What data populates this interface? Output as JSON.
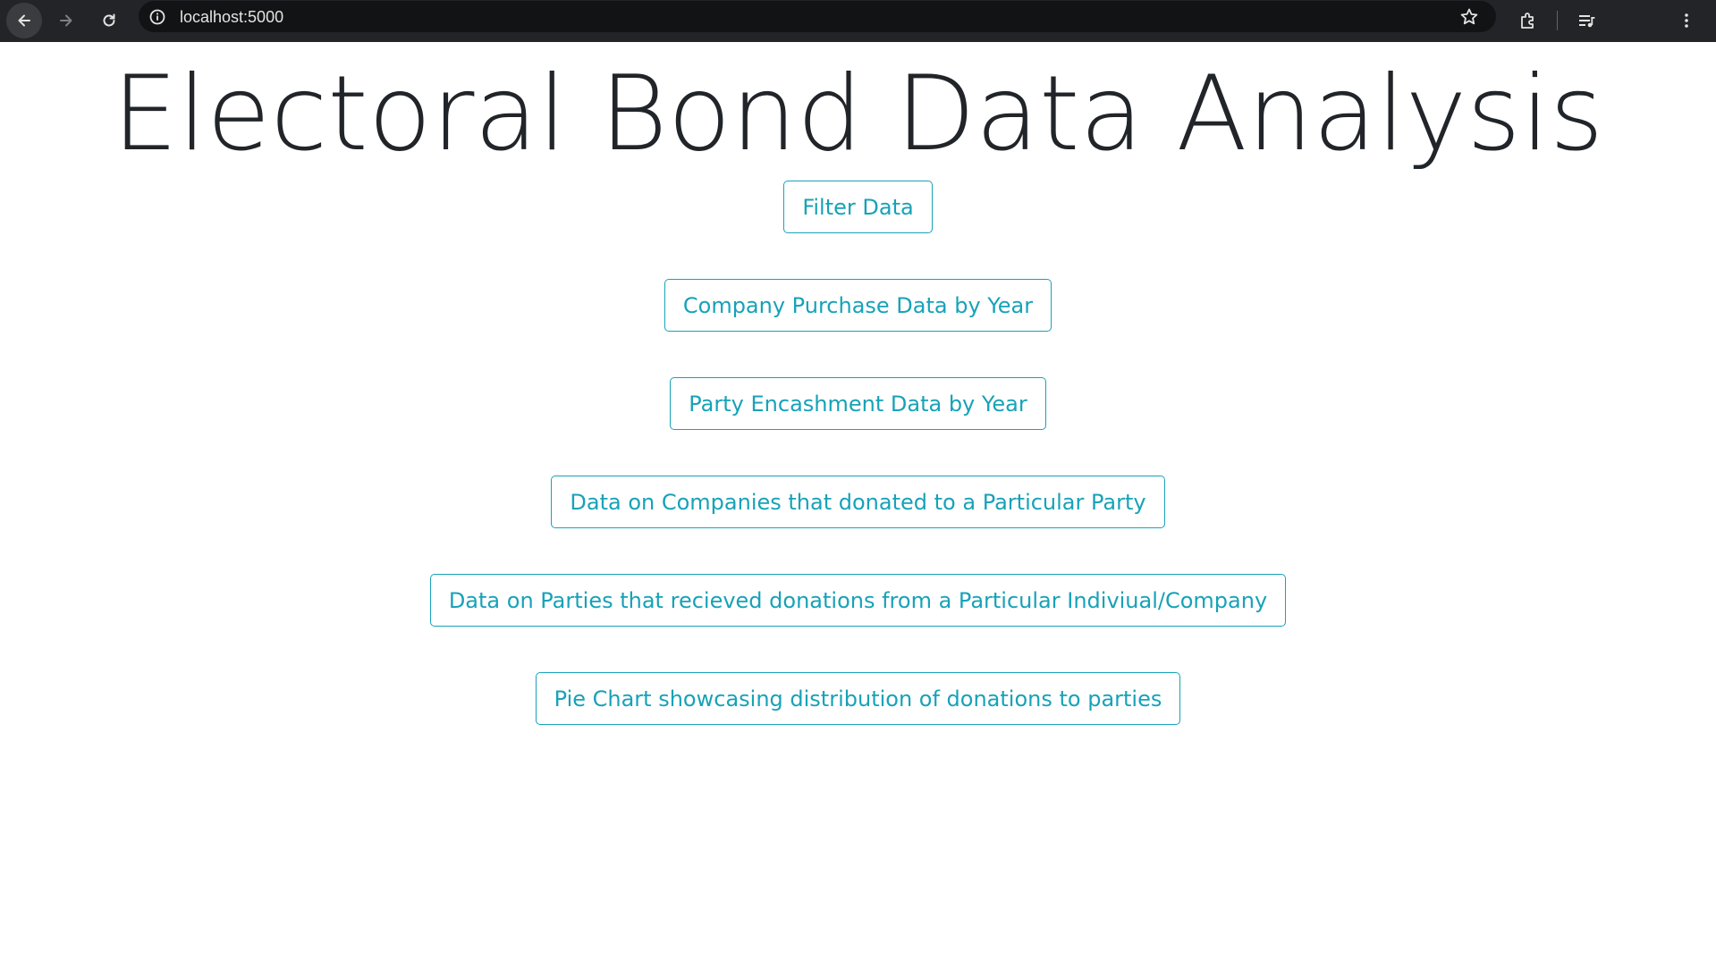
{
  "browser": {
    "url": "localhost:5000",
    "icons": [
      "back-arrow-icon",
      "forward-arrow-icon",
      "reload-icon",
      "site-info-icon",
      "star-icon",
      "extensions-icon",
      "media-queue-icon",
      "kebab-menu-icon"
    ]
  },
  "page": {
    "title": "Electoral Bond Data Analysis",
    "buttons": [
      {
        "label": "Filter Data"
      },
      {
        "label": "Company Purchase Data by Year"
      },
      {
        "label": "Party Encashment Data by Year"
      },
      {
        "label": "Data on Companies that donated to a Particular Party"
      },
      {
        "label": "Data on Parties that recieved donations from a Particular Indiviual/Company"
      },
      {
        "label": "Pie Chart showcasing distribution of donations to parties"
      }
    ]
  },
  "colors": {
    "accent": "#17a2b8",
    "title_text": "#212529",
    "browser_bar": "#232427"
  }
}
